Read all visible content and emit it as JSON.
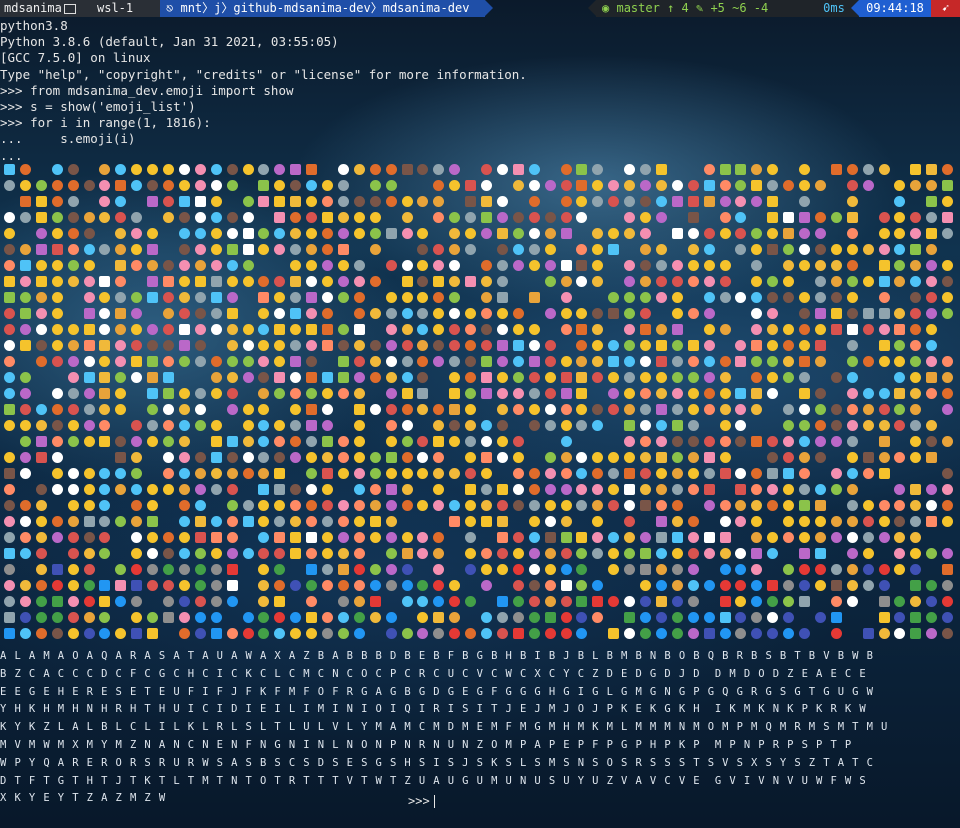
{
  "prompt_bar": {
    "user": "mdsanima",
    "host": "wsl-1",
    "path": [
      "mnt",
      "j",
      "github-mdsanima-dev",
      "mdsanima-dev"
    ],
    "git_branch": "master",
    "git_ahead": "↑ 4",
    "git_status": "+5 ~6 -4",
    "exec_time": "0ms",
    "clock": "09:44:18",
    "colors": {
      "path_bg": "#1f4fa8",
      "clock_bg": "#1f5fd1",
      "end_bg": "#c62828",
      "git_fg": "#8fd14f"
    }
  },
  "terminal_lines": [
    "python3.8",
    "Python 3.8.6 (default, Jan 31 2021, 03:55:05)",
    "[GCC 7.5.0] on linux",
    "Type \"help\", \"copyright\", \"credits\" or \"license\" for more information.",
    ">>> from mdsanima_dev.emoji import show",
    ">>> s = show('emoji_list')",
    ">>> for i in range(1, 1816):",
    "...     s.emoji(i)",
    "..."
  ],
  "letter_rows": [
    "A L A M A O A Q A R A S A T A U A W A X A Z B A B B B D B E B F B G B H B I B J B L B M B N B O B Q B R B S B T B V B W B",
    "B Z C A C C C D C F C G C H C I C K C L C M C N C O C P C R C U C V C W C X C Y C Z D E D G D J D  D M D O D Z E A E C E",
    "E E G E H E R E S E T E U F I F J F K F M F O F R G A G B G D G E G F G G G H G I G L G M G N G P G Q G R G S G T G U G W",
    "Y H K H M H N H R H T H U I C I D I E I L I M I N I O I Q I R I S I T J E J M J O J P K E K G K H  I K M K N K P K R K W",
    "K Y K Z L A L B L C L I L K L R L S L T L U L V L Y M A M C M D M E M F M G M H M K M L M M M N M O M P M Q M R M S M T M U",
    "M V M W M X M Y M Z N A N C N E N F N G N I N L N O N P N R N U N Z O M P A P E P F P G P H P K P  M P N P R P S P T P",
    "W P Y Q A R E R O R S R U R W S A S B S C S D S E S G S H S I S J S K S L S M S N S O S R S S S T S V S X S Y S Z T A T C",
    "D T F T G T H T J T K T L T M T N T O T R T T T V T W T Z U A U G U M U N U S U Y U Z V A V C V E  G V I V N V U W F W S",
    "X K Y E Y T Z A Z M Z W"
  ],
  "final_prompt": ">>>"
}
